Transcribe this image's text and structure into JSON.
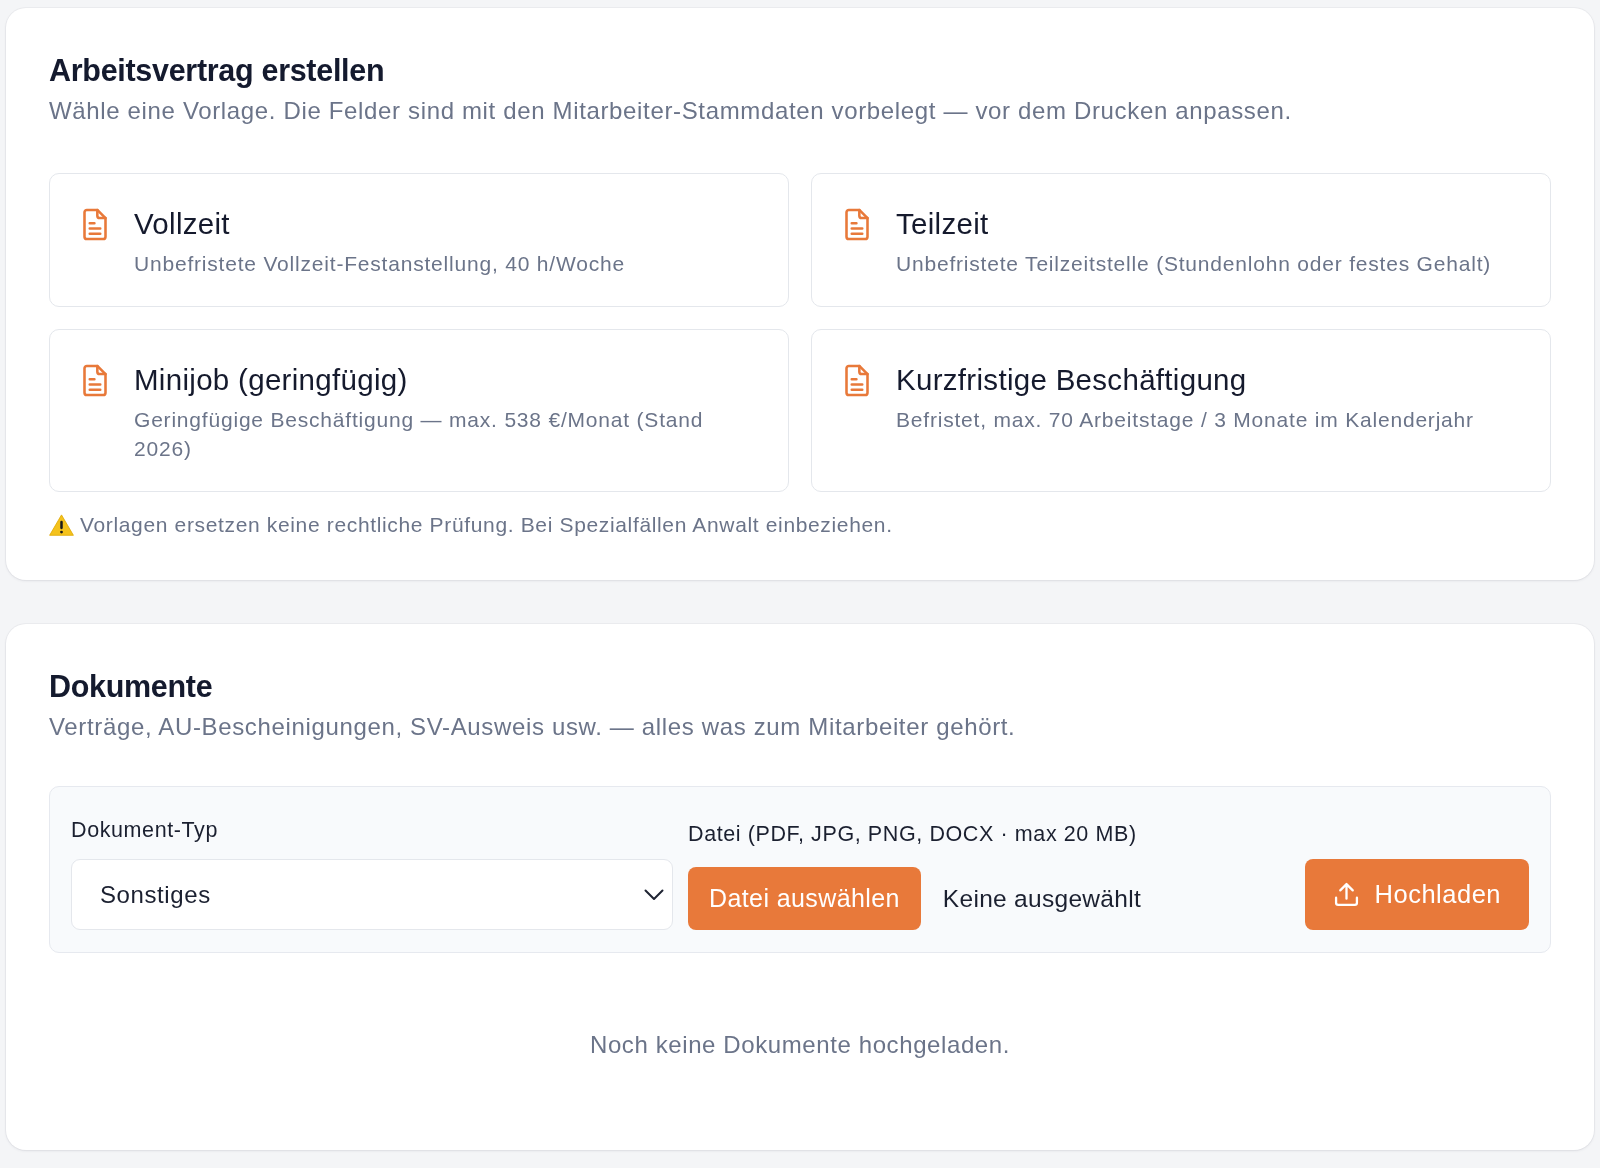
{
  "contract_section": {
    "title": "Arbeitsvertrag erstellen",
    "subtitle": "Wähle eine Vorlage. Die Felder sind mit den Mitarbeiter-Stammdaten vorbelegt — vor dem Drucken anpassen.",
    "templates": [
      {
        "title": "Vollzeit",
        "description": "Unbefristete Vollzeit-Festanstellung, 40 h/Woche"
      },
      {
        "title": "Teilzeit",
        "description": "Unbefristete Teilzeitstelle (Stundenlohn oder festes Gehalt)"
      },
      {
        "title": "Minijob (geringfügig)",
        "description": "Geringfügige Beschäftigung — max. 538 €/Monat (Stand 2026)"
      },
      {
        "title": "Kurzfristige Beschäftigung",
        "description": "Befristet, max. 70 Arbeitstage / 3 Monate im Kalenderjahr"
      }
    ],
    "notice": "Vorlagen ersetzen keine rechtliche Prüfung. Bei Spezialfällen Anwalt einbeziehen."
  },
  "documents_section": {
    "title": "Dokumente",
    "subtitle": "Verträge, AU-Bescheinigungen, SV-Ausweis usw. — alles was zum Mitarbeiter gehört.",
    "upload_form": {
      "type_label": "Dokument-Typ",
      "type_select": {
        "value": "Sonstiges"
      },
      "file_label": "Datei (PDF, JPG, PNG, DOCX · max 20 MB)",
      "choose_button": "Datei auswählen",
      "file_status": "Keine ausgewählt",
      "upload_button": "Hochladen"
    },
    "empty_message": "Noch keine Dokumente hochgeladen."
  }
}
